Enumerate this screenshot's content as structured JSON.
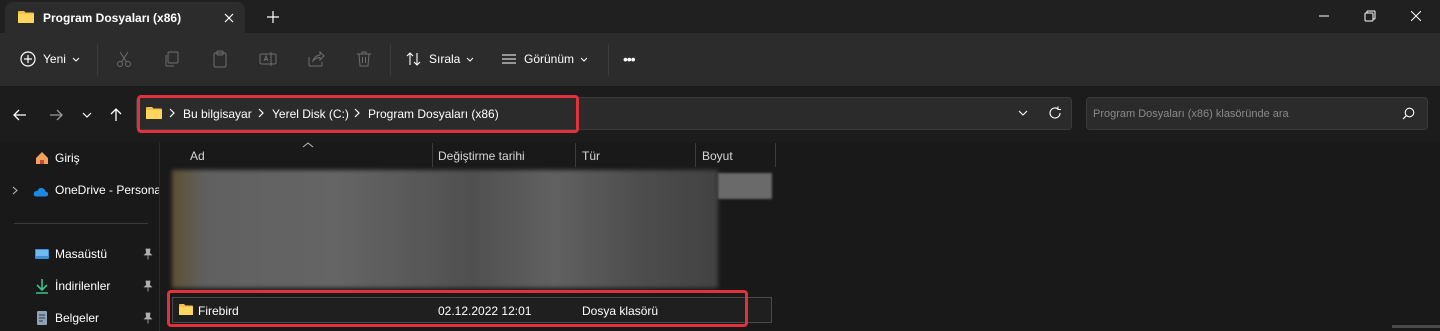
{
  "window": {
    "tab_title": "Program Dosyaları (x86)",
    "icons": [
      "folder-icon",
      "close-icon",
      "plus-icon",
      "minimize-icon",
      "maximize-icon",
      "close-window-icon"
    ]
  },
  "toolbar": {
    "new_label": "Yeni",
    "sort_label": "Sırala",
    "view_label": "Görünüm",
    "more_label": "•••",
    "icons": [
      "cut-icon",
      "copy-icon",
      "paste-icon",
      "rename-icon",
      "share-icon",
      "delete-icon"
    ]
  },
  "address": {
    "crumbs": [
      "Bu bilgisayar",
      "Yerel Disk (C:)",
      "Program Dosyaları (x86)"
    ],
    "search_placeholder": "Program Dosyaları (x86) klasöründe ara"
  },
  "sidebar": {
    "items": [
      {
        "label": "Giriş",
        "icon": "home-icon"
      },
      {
        "label": "OneDrive - Persona",
        "icon": "onedrive-icon"
      },
      {
        "label": "Masaüstü",
        "icon": "desktop-icon",
        "pinned": true
      },
      {
        "label": "İndirilenler",
        "icon": "download-icon",
        "pinned": true
      },
      {
        "label": "Belgeler",
        "icon": "documents-icon",
        "pinned": true
      }
    ]
  },
  "columns": {
    "name": "Ad",
    "modified": "Değiştirme tarihi",
    "type": "Tür",
    "size": "Boyut"
  },
  "files": [
    {
      "name": "Firebird",
      "modified": "02.12.2022 12:01",
      "type": "Dosya klasörü",
      "size": ""
    }
  ],
  "colors": {
    "highlight": "#e0323a",
    "folder": "#f2c14e"
  }
}
